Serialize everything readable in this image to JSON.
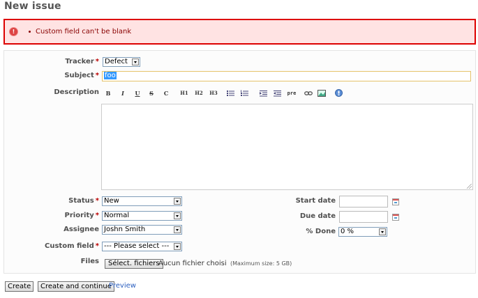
{
  "page": {
    "title": "New issue"
  },
  "flash": {
    "message": "Custom field can't be blank",
    "icon": "exclamation-icon",
    "icon_glyph": "!"
  },
  "required_mark": "*",
  "form": {
    "tracker": {
      "label": "Tracker",
      "value": "Defect"
    },
    "subject": {
      "label": "Subject",
      "value": "foo"
    },
    "description": {
      "label": "Description"
    },
    "status": {
      "label": "Status",
      "value": "New"
    },
    "priority": {
      "label": "Priority",
      "value": "Normal"
    },
    "assignee": {
      "label": "Assignee",
      "value": "Joshn Smith"
    },
    "custom_field": {
      "label": "Custom field",
      "value": "--- Please select ---"
    },
    "start_date": {
      "label": "Start date",
      "value": ""
    },
    "due_date": {
      "label": "Due date",
      "value": ""
    },
    "done_ratio": {
      "label": "% Done",
      "value": "0 %"
    },
    "files": {
      "label": "Files",
      "button": "Sélect. fichiers",
      "none_chosen": "Aucun fichier choisi",
      "max_size": "(Maximum size: 5 GB)"
    }
  },
  "toolbar": {
    "bold": "B",
    "italic": "I",
    "underline": "U",
    "strike": "S",
    "code": "C",
    "h1": "H1",
    "h2": "H2",
    "h3": "H3",
    "pre": "pre"
  },
  "actions": {
    "create": "Create",
    "create_continue": "Create and continue",
    "preview": "Preview"
  }
}
